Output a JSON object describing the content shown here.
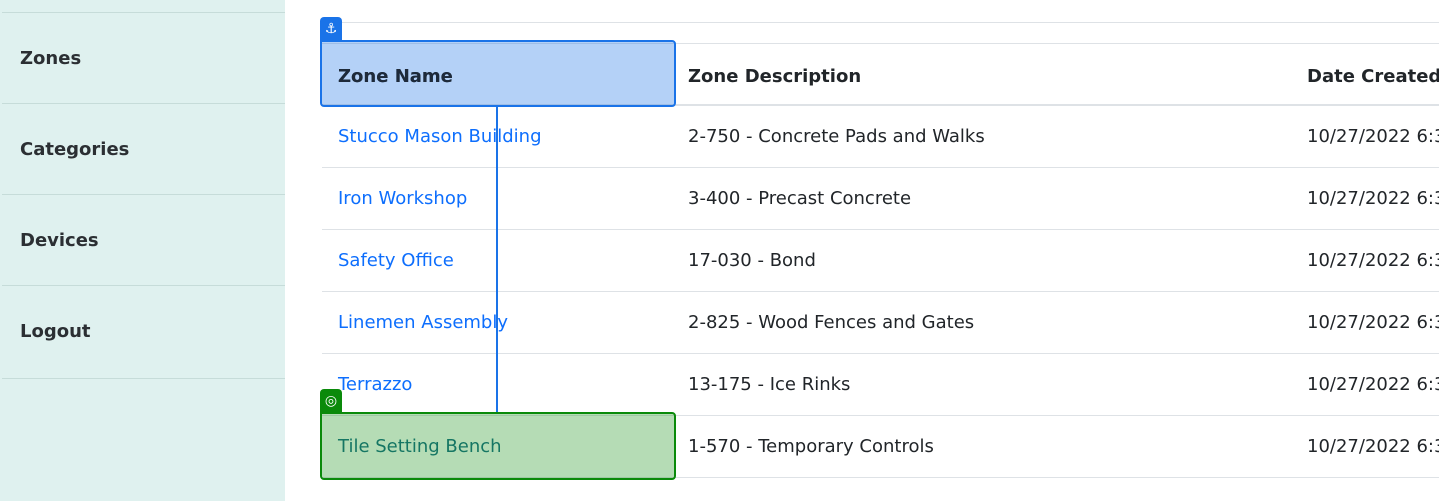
{
  "sidebar": {
    "items": [
      {
        "label": "Zones"
      },
      {
        "label": "Categories"
      },
      {
        "label": "Devices"
      },
      {
        "label": "Logout"
      }
    ]
  },
  "table": {
    "headers": [
      "Zone Name",
      "Zone Description",
      "Date Created"
    ],
    "rows": [
      [
        "Stucco Mason Building",
        "2-750 - Concrete Pads and Walks",
        "10/27/2022 6:3"
      ],
      [
        "Iron Workshop",
        "3-400 - Precast Concrete",
        "10/27/2022 6:3"
      ],
      [
        "Safety Office",
        "17-030 - Bond",
        "10/27/2022 6:3"
      ],
      [
        "Linemen Assembly",
        "2-825 - Wood Fences and Gates",
        "10/27/2022 6:3"
      ],
      [
        "Terrazzo",
        "13-175 - Ice Rinks",
        "10/27/2022 6:3"
      ],
      [
        "Tile Setting Bench",
        "1-570 - Temporary Controls",
        "10/27/2022 6:3"
      ]
    ]
  },
  "overlay": {
    "source_icon": "anchor-icon",
    "target_icon": "target-icon",
    "source_color": "#1a73e8",
    "target_color": "#0a8a0a"
  }
}
